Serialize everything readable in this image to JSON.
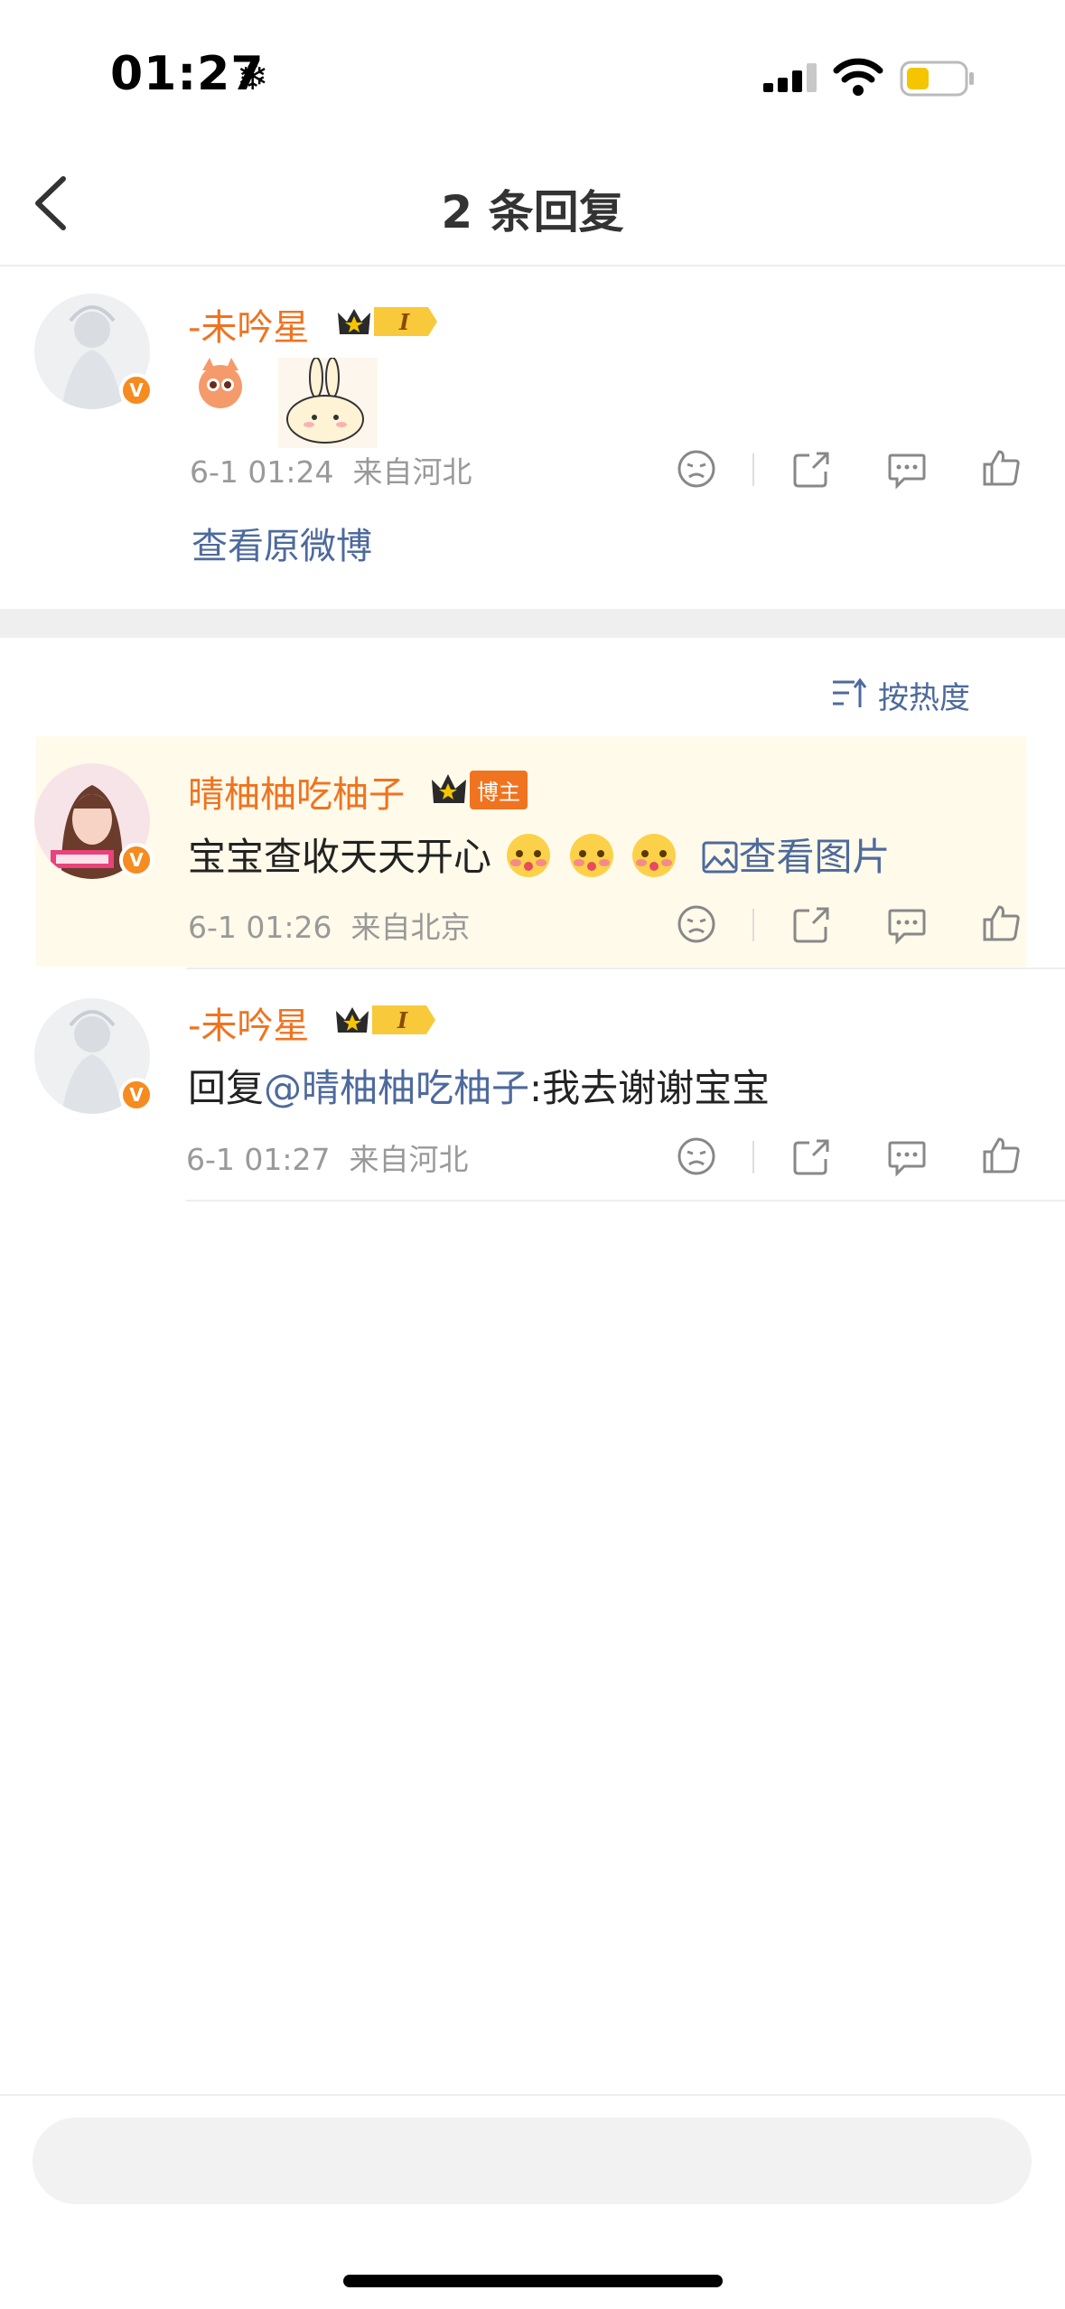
{
  "status_bar": {
    "time": "01:27",
    "snow_glyph": "❄",
    "battery_color": "#f5c500"
  },
  "nav": {
    "title": "2 条回复"
  },
  "original_comment": {
    "username": "-未吟星",
    "badge_text": "I",
    "time": "6-1 01:24",
    "location": "来自河北",
    "view_original": "查看原微博"
  },
  "sort": {
    "label": "按热度"
  },
  "replies": [
    {
      "username": "晴柚柚吃柚子",
      "role_badge": "博主",
      "text": "宝宝查收天天开心",
      "view_image": "查看图片",
      "time": "6-1 01:26",
      "location": "来自北京"
    },
    {
      "username": "-未吟星",
      "badge_text": "I",
      "reply_prefix": "回复",
      "mention": "@晴柚柚吃柚子",
      "text": ":我去谢谢宝宝",
      "time": "6-1 01:27",
      "location": "来自河北"
    }
  ],
  "input": {
    "placeholder": ""
  },
  "colors": {
    "accent": "#f07320",
    "link": "#4d6a9c",
    "highlight": "#fffaea"
  }
}
